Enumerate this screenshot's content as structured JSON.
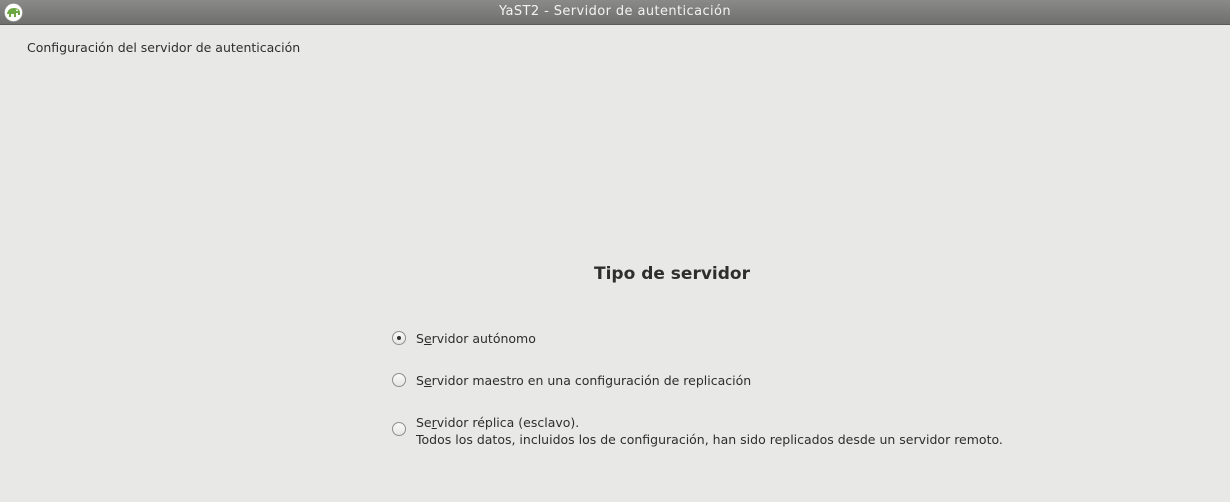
{
  "window": {
    "title": "YaST2 - Servidor de autenticación",
    "icon": "yast-chameleon-icon"
  },
  "subtitle": "Configuración del servidor de autenticación",
  "heading": "Tipo de servidor",
  "options": [
    {
      "label_first": "S",
      "label_accel": "e",
      "label_rest": "rvidor autónomo",
      "description": "",
      "selected": true
    },
    {
      "label_first": "S",
      "label_accel": "e",
      "label_rest": "rvidor maestro en una configuración de replicación",
      "description": "",
      "selected": false
    },
    {
      "label_first": "Se",
      "label_accel": "r",
      "label_rest": "vidor réplica (esclavo).",
      "description": "Todos los datos, incluidos los de configuración, han sido replicados desde un servidor remoto.",
      "selected": false
    }
  ]
}
